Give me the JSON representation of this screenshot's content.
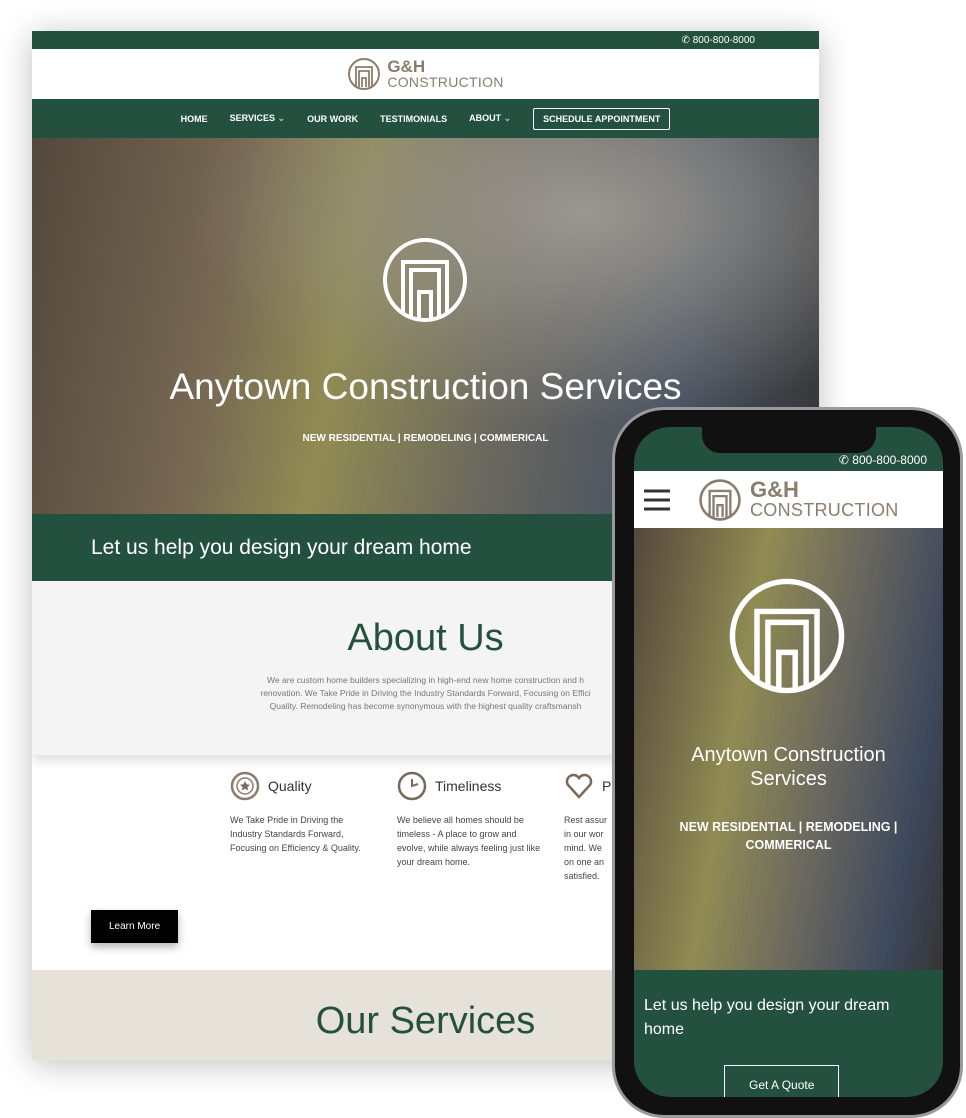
{
  "desktop": {
    "phone": "800-800-8000",
    "logo": {
      "line1": "G&H",
      "line2": "CONSTRUCTION"
    },
    "nav": [
      {
        "label": "HOME"
      },
      {
        "label": "SERVICES",
        "dropdown": true
      },
      {
        "label": "OUR WORK"
      },
      {
        "label": "TESTIMONIALS"
      },
      {
        "label": "ABOUT",
        "dropdown": true
      }
    ],
    "nav_cta": "SCHEDULE APPOINTMENT",
    "hero": {
      "title": "Anytown Construction Services",
      "subtitle": "NEW RESIDENTIAL | REMODELING | COMMERICAL"
    },
    "band": "Let us help you design your dream home",
    "about": {
      "title": "About Us",
      "lines": [
        "We are custom home builders specializing in high-end new home construction and h",
        "renovation. We Take Pride in Driving the Industry Standards Forward, Focusing on Effici",
        "Quality. Remodeling has become synonymous with the highest quality craftsmansh"
      ]
    },
    "features": [
      {
        "icon": "star-badge-icon",
        "title": "Quality",
        "text": "We Take Pride in Driving the Industry Standards Forward, Focusing on Efficiency & Quality."
      },
      {
        "icon": "clock-icon",
        "title": "Timeliness",
        "text": "We believe all homes should be timeless - A place to grow and evolve, while always feeling just like your dream home."
      },
      {
        "icon": "heart-icon",
        "title": "P",
        "text": "Rest assur in our wor mind. We on one an satisfied."
      }
    ],
    "learn_more": "Learn More",
    "services_title": "Our Services"
  },
  "mobile": {
    "phone": "800-800-8000",
    "logo": {
      "line1": "G&H",
      "line2": "CONSTRUCTION"
    },
    "hero": {
      "title": "Anytown Construction Services",
      "subtitle": "NEW RESIDENTIAL | REMODELING | COMMERICAL"
    },
    "band": "Let us help you design your dream home",
    "cta": "Get A Quote"
  },
  "colors": {
    "brand_green": "#24513f",
    "logo_taupe": "#8a7d6c",
    "services_bg": "#e6e2da"
  }
}
